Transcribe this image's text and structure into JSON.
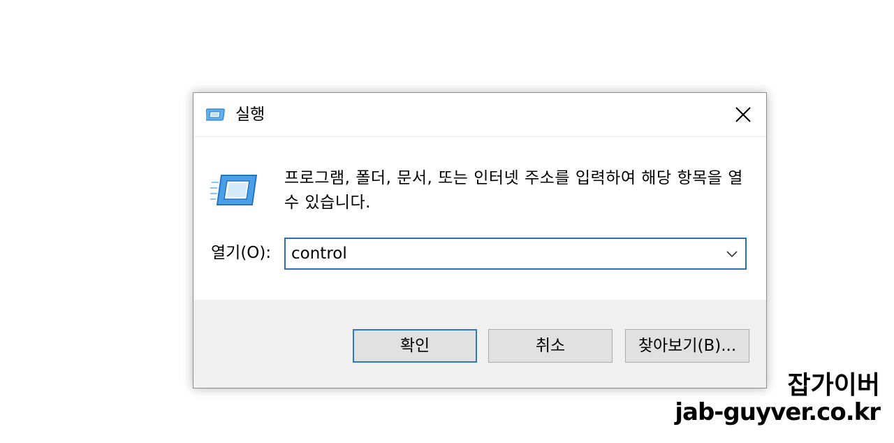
{
  "dialog": {
    "title": "실행",
    "description": "프로그램, 폴더, 문서, 또는 인터넷 주소를 입력하여 해당 항목을 열 수 있습니다.",
    "open_label": "열기(O):",
    "open_value": "control",
    "buttons": {
      "ok": "확인",
      "cancel": "취소",
      "browse": "찾아보기(B)..."
    },
    "icons": {
      "title": "run-app-icon",
      "main": "run-app-icon",
      "close": "close-icon",
      "dropdown": "chevron-down-icon"
    }
  },
  "watermark": {
    "name": "잡가이버",
    "url": "jab-guyver.co.kr"
  },
  "colors": {
    "accent_border": "#2e79c6",
    "footer_bg": "#f0f0f0",
    "button_bg": "#e1e1e1",
    "icon_blue": "#4aa0e6"
  }
}
